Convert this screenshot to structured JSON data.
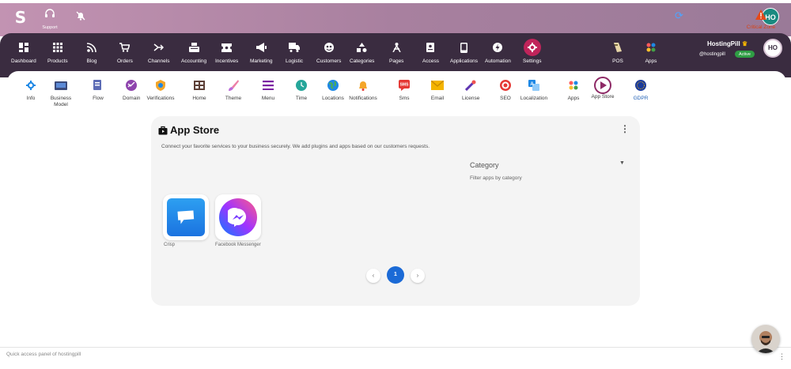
{
  "topbar": {
    "logo_letter": "S",
    "support_label": "Support",
    "avatar_initials": "HO",
    "gradient_colors": [
      "#c293b2",
      "#9a7a98"
    ]
  },
  "main_nav": {
    "items": [
      {
        "label": "Dashboard",
        "icon": "dashboard-icon"
      },
      {
        "label": "Products",
        "icon": "grid-icon"
      },
      {
        "label": "Blog",
        "icon": "rss-icon"
      },
      {
        "label": "Orders",
        "icon": "cart-icon"
      },
      {
        "label": "Channels",
        "icon": "channels-icon"
      },
      {
        "label": "Accounting",
        "icon": "register-icon"
      },
      {
        "label": "Incentives",
        "icon": "ticket-icon"
      },
      {
        "label": "Marketing",
        "icon": "megaphone-icon"
      },
      {
        "label": "Logistic",
        "icon": "truck-icon"
      },
      {
        "label": "Customers",
        "icon": "customers-icon"
      },
      {
        "label": "Categories",
        "icon": "shapes-icon"
      },
      {
        "label": "Pages",
        "icon": "pages-icon"
      },
      {
        "label": "Access",
        "icon": "id-card-icon"
      },
      {
        "label": "Applications",
        "icon": "phone-icon"
      },
      {
        "label": "Automation",
        "icon": "bolt-icon"
      },
      {
        "label": "Settings",
        "icon": "gear-icon"
      }
    ],
    "right_items": [
      {
        "label": "POS",
        "icon": "pos-icon"
      },
      {
        "label": "Apps",
        "icon": "apps-icon"
      }
    ],
    "user_name": "HostingPill",
    "user_handle": "@hostingpill",
    "status": "Active",
    "avatar_initials": "HO",
    "background": "#3a2c40",
    "settings_color": "#c0245a"
  },
  "sub_nav": {
    "items": [
      {
        "label": "Info",
        "icon": "gear-blue-icon"
      },
      {
        "label": "Business\nModel",
        "icon": "business-icon"
      },
      {
        "label": "Flow",
        "icon": "flow-icon"
      },
      {
        "label": "Domain",
        "icon": "domain-icon"
      },
      {
        "label": "Verifications",
        "icon": "badge-icon"
      },
      {
        "label": "Home",
        "icon": "home-icon"
      },
      {
        "label": "Theme",
        "icon": "brush-icon"
      },
      {
        "label": "Menu",
        "icon": "menu-icon"
      },
      {
        "label": "Time",
        "icon": "clock-icon"
      },
      {
        "label": "Locations",
        "icon": "globe-icon"
      },
      {
        "label": "Notifications",
        "icon": "bell-icon"
      },
      {
        "label": "Sms",
        "icon": "sms-icon"
      },
      {
        "label": "Email",
        "icon": "envelope-icon"
      },
      {
        "label": "License",
        "icon": "key-icon"
      },
      {
        "label": "SEO",
        "icon": "target-icon"
      },
      {
        "label": "Localization",
        "icon": "translate-icon"
      },
      {
        "label": "Apps",
        "icon": "apps-dots-icon"
      },
      {
        "label": "App Store",
        "icon": "play-icon"
      },
      {
        "label": "GDPR",
        "icon": "gdpr-icon"
      }
    ],
    "critical_label": "Critical Zone",
    "critical_color": "#d84315"
  },
  "app_store": {
    "title": "App Store",
    "description": "Connect your favorite services to your business securely. We add plugins and apps based on our customers requests.",
    "category_label": "Category",
    "category_hint": "Filter apps by category",
    "apps": [
      {
        "name": "Crisp",
        "icon": "crisp-icon"
      },
      {
        "name": "Facebook Messenger",
        "icon": "messenger-icon"
      }
    ],
    "page": "1"
  },
  "footer": {
    "text": "Quick access panel of hostingpill"
  }
}
